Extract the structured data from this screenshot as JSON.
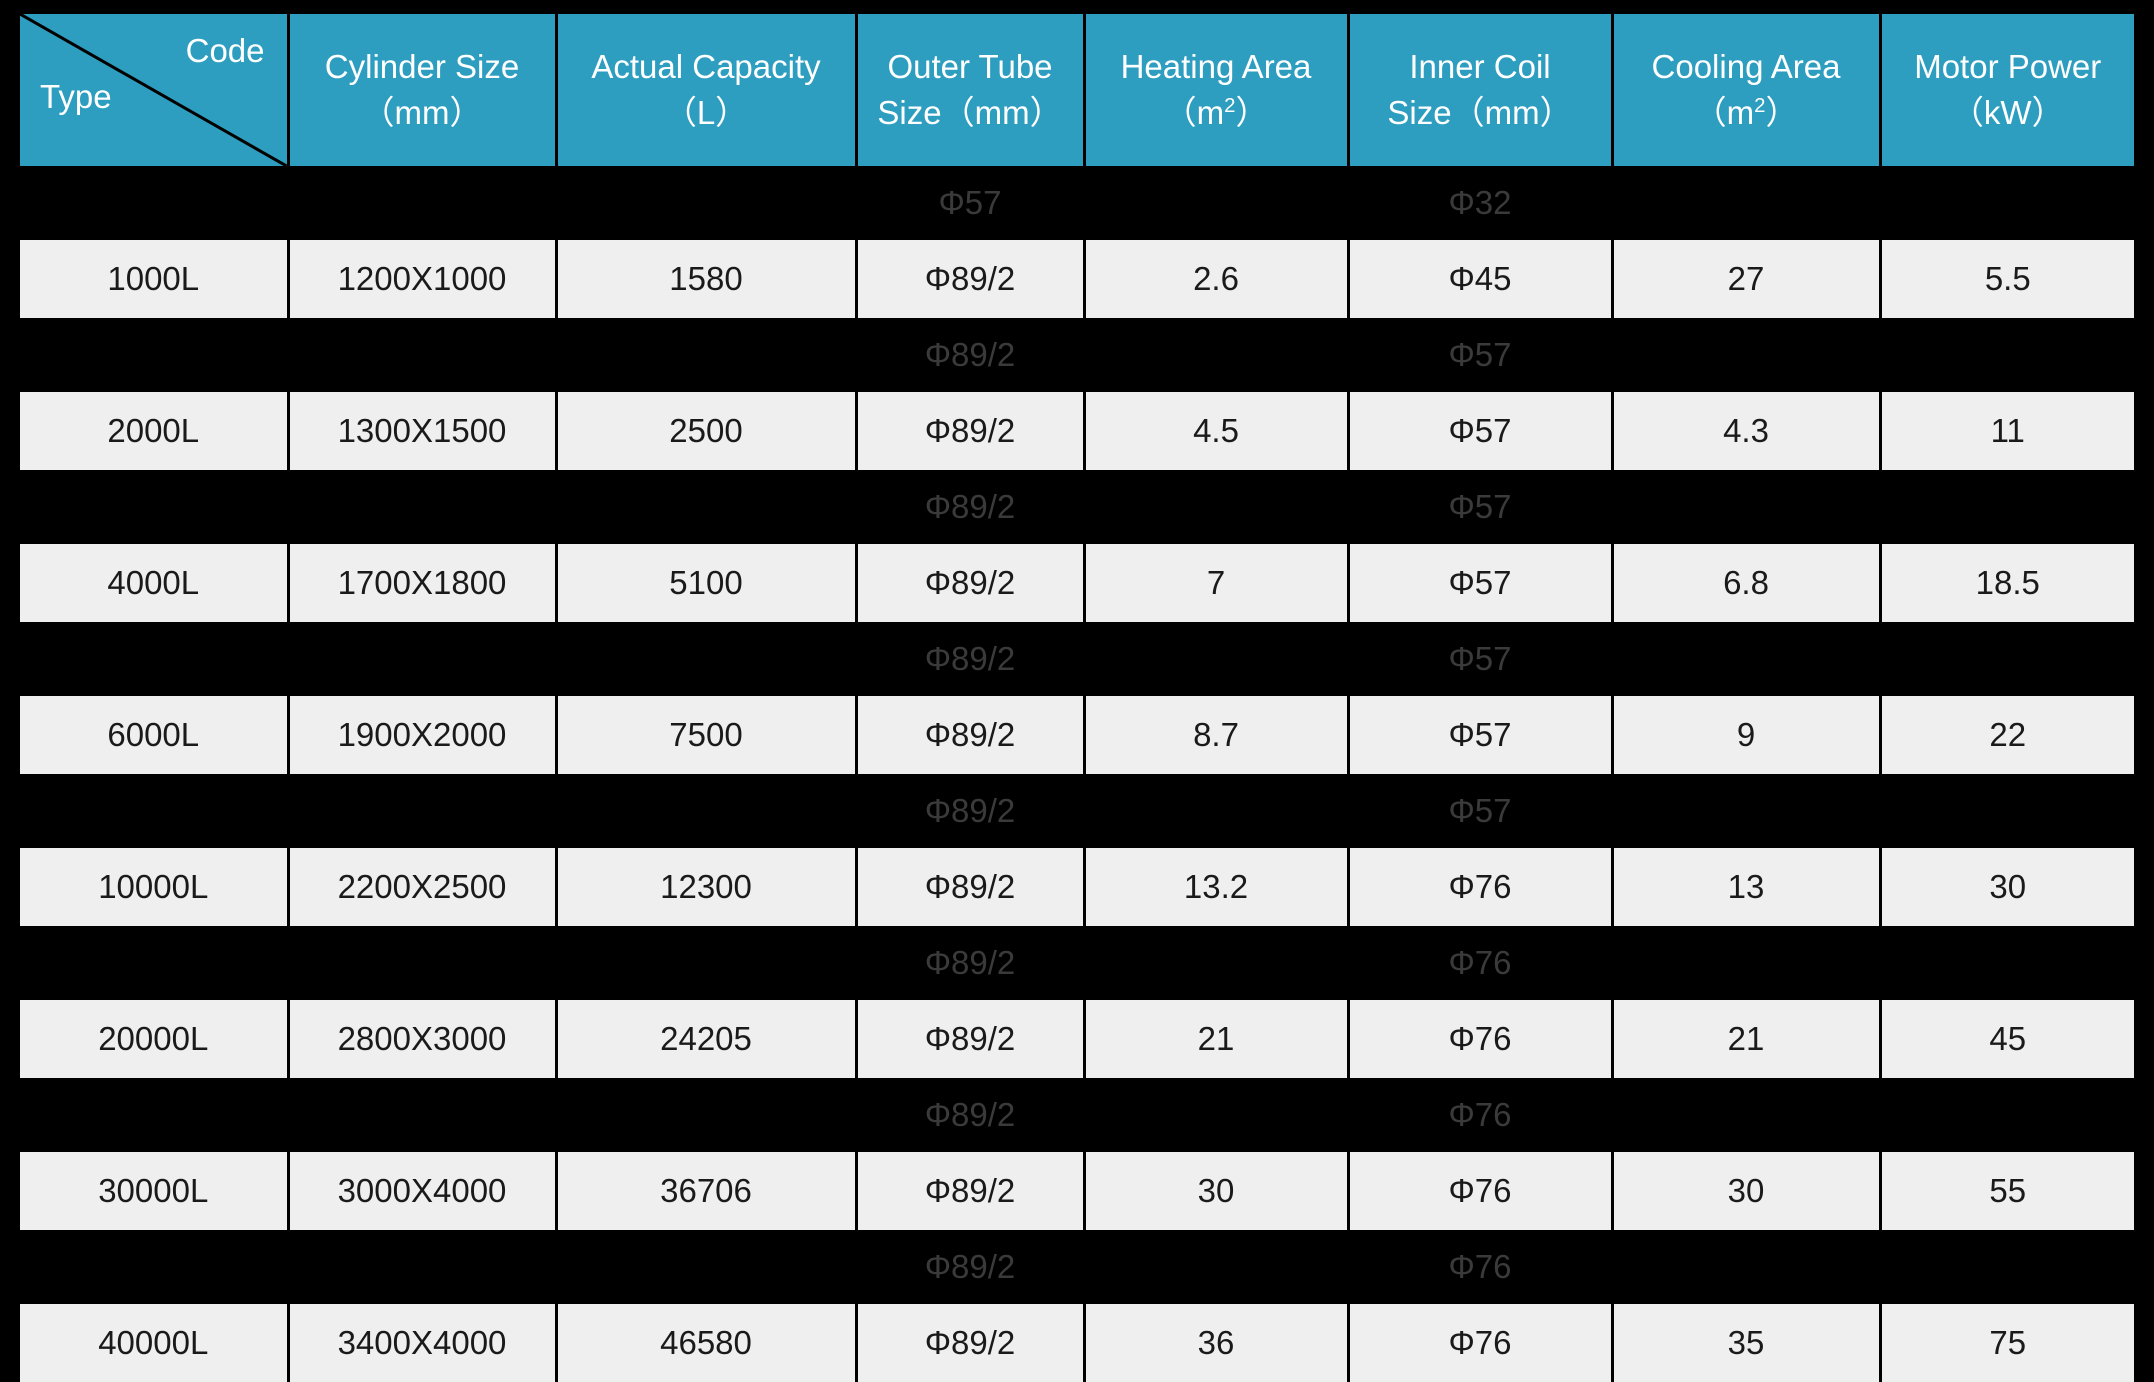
{
  "table": {
    "corner_cell": {
      "code_label": "Code",
      "type_label": "Type",
      "divider": "diagonal-line"
    },
    "header_accent_color": "#2e9ec0",
    "row_bg_color": "#efefef",
    "gap_bg_color": "#000000",
    "columns": [
      {
        "line1": "Code",
        "line2": "Type"
      },
      {
        "line1": "Cylinder Size",
        "line2": "（mm）"
      },
      {
        "line1": "Actual Capacity",
        "line2": "（L）"
      },
      {
        "line1": "Outer Tube",
        "line2": "Size（mm）"
      },
      {
        "line1": "Heating Area",
        "line2": "（m2）"
      },
      {
        "line1": "Inner Coil",
        "line2": "Size（mm）"
      },
      {
        "line1": "Cooling Area",
        "line2": "（m2）"
      },
      {
        "line1": "Motor Power",
        "line2": "（kW）"
      }
    ],
    "gap_rows": [
      {
        "outer_tube": "Φ57",
        "inner_coil": "Φ32"
      },
      {
        "outer_tube": "Φ89/2",
        "inner_coil": "Φ57"
      },
      {
        "outer_tube": "Φ89/2",
        "inner_coil": "Φ57"
      },
      {
        "outer_tube": "Φ89/2",
        "inner_coil": "Φ57"
      },
      {
        "outer_tube": "Φ89/2",
        "inner_coil": "Φ57"
      },
      {
        "outer_tube": "Φ89/2",
        "inner_coil": "Φ76"
      },
      {
        "outer_tube": "Φ89/2",
        "inner_coil": "Φ76"
      },
      {
        "outer_tube": "Φ89/2",
        "inner_coil": "Φ76"
      }
    ],
    "rows": [
      {
        "type": "1000L",
        "cylinder_size": "1200X1000",
        "actual_capacity": "1580",
        "outer_tube_size": "Φ89/2",
        "heating_area": "2.6",
        "inner_coil_size": "Φ45",
        "cooling_area": "27",
        "motor_power": "5.5"
      },
      {
        "type": "2000L",
        "cylinder_size": "1300X1500",
        "actual_capacity": "2500",
        "outer_tube_size": "Φ89/2",
        "heating_area": "4.5",
        "inner_coil_size": "Φ57",
        "cooling_area": "4.3",
        "motor_power": "11"
      },
      {
        "type": "4000L",
        "cylinder_size": "1700X1800",
        "actual_capacity": "5100",
        "outer_tube_size": "Φ89/2",
        "heating_area": "7",
        "inner_coil_size": "Φ57",
        "cooling_area": "6.8",
        "motor_power": "18.5"
      },
      {
        "type": "6000L",
        "cylinder_size": "1900X2000",
        "actual_capacity": "7500",
        "outer_tube_size": "Φ89/2",
        "heating_area": "8.7",
        "inner_coil_size": "Φ57",
        "cooling_area": "9",
        "motor_power": "22"
      },
      {
        "type": "10000L",
        "cylinder_size": "2200X2500",
        "actual_capacity": "12300",
        "outer_tube_size": "Φ89/2",
        "heating_area": "13.2",
        "inner_coil_size": "Φ76",
        "cooling_area": "13",
        "motor_power": "30"
      },
      {
        "type": "20000L",
        "cylinder_size": "2800X3000",
        "actual_capacity": "24205",
        "outer_tube_size": "Φ89/2",
        "heating_area": "21",
        "inner_coil_size": "Φ76",
        "cooling_area": "21",
        "motor_power": "45"
      },
      {
        "type": "30000L",
        "cylinder_size": "3000X4000",
        "actual_capacity": "36706",
        "outer_tube_size": "Φ89/2",
        "heating_area": "30",
        "inner_coil_size": "Φ76",
        "cooling_area": "30",
        "motor_power": "55"
      },
      {
        "type": "40000L",
        "cylinder_size": "3400X4000",
        "actual_capacity": "46580",
        "outer_tube_size": "Φ89/2",
        "heating_area": "36",
        "inner_coil_size": "Φ76",
        "cooling_area": "35",
        "motor_power": "75"
      }
    ]
  }
}
